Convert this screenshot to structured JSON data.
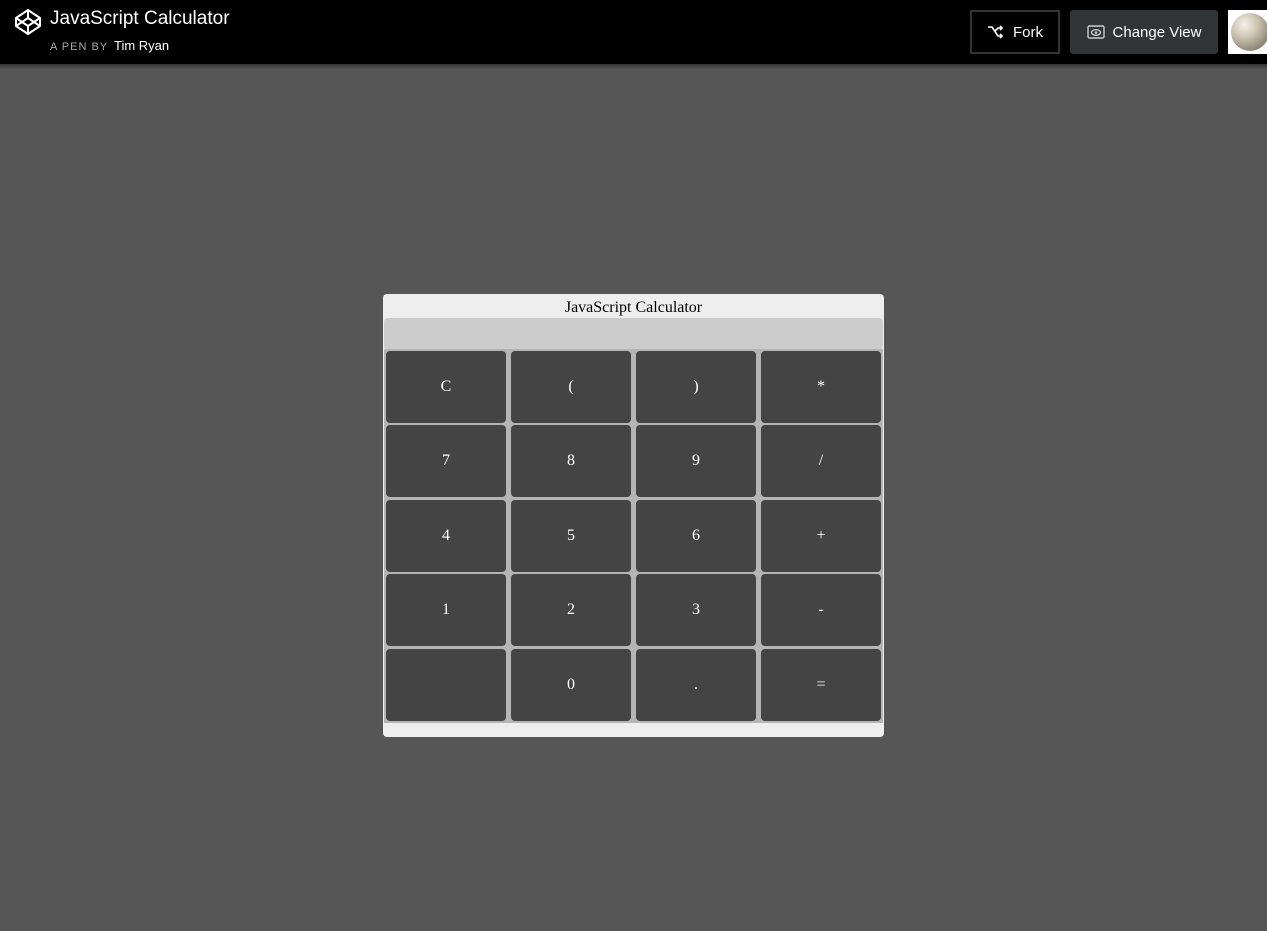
{
  "header": {
    "title": "JavaScript Calculator",
    "by_prefix": "A PEN BY",
    "author": "Tim Ryan",
    "fork_label": "Fork",
    "change_view_label": "Change View"
  },
  "calculator": {
    "title": "JavaScript Calculator",
    "display_value": "",
    "keys": {
      "clear": "C",
      "open_paren": "(",
      "close_paren": ")",
      "multiply": "*",
      "seven": "7",
      "eight": "8",
      "nine": "9",
      "divide": "/",
      "four": "4",
      "five": "5",
      "six": "6",
      "plus": "+",
      "one": "1",
      "two": "2",
      "three": "3",
      "minus": "-",
      "blank": "",
      "zero": "0",
      "decimal": ".",
      "equals": "="
    }
  },
  "colors": {
    "page_background": "#565656",
    "topbar": "#000000",
    "key_background": "#444444",
    "display_background": "#cccccc",
    "calc_background": "#eeeeee"
  },
  "icons": [
    "codepen-logo-icon",
    "fork-icon",
    "eye-icon",
    "avatar"
  ]
}
